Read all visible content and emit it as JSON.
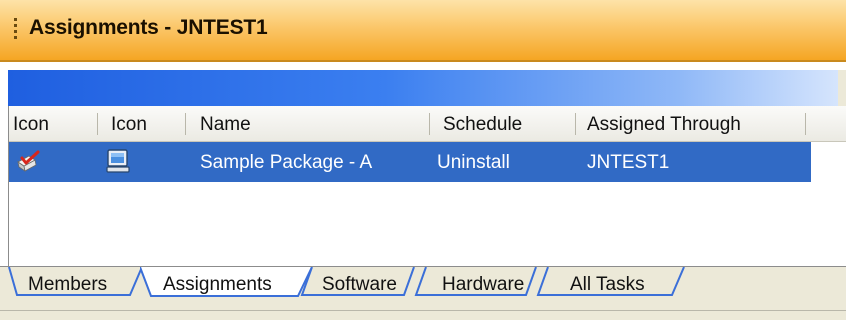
{
  "panel": {
    "title": "Assignments - JNTEST1"
  },
  "list": {
    "columns": [
      "Icon",
      "Icon",
      "Name",
      "Schedule",
      "Assigned Through"
    ],
    "rows": [
      {
        "icon1": "package-check-icon",
        "icon2": "computer-icon",
        "name": "Sample Package - A",
        "schedule": "Uninstall",
        "assigned_through": "JNTEST1"
      }
    ],
    "selection_color": "#316ac5"
  },
  "tabs": [
    {
      "label": "Members",
      "selected": false
    },
    {
      "label": "Assignments",
      "selected": true
    },
    {
      "label": "Software",
      "selected": false
    },
    {
      "label": "Hardware",
      "selected": false
    },
    {
      "label": "All Tasks",
      "selected": false
    }
  ],
  "colors": {
    "title_gradient_top": "#fde3a8",
    "title_gradient_bottom": "#f5a623",
    "band_blue": "#1f5fe0",
    "tab_highlight": "#3b6fd8"
  }
}
